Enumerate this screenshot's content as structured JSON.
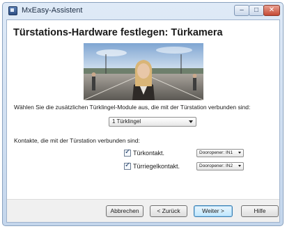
{
  "window": {
    "title": "MxEasy-Assistent",
    "minimize_symbol": "–",
    "maximize_symbol": "□",
    "close_symbol": "✕"
  },
  "page": {
    "heading": "Türstations-Hardware festlegen: Türkamera",
    "camera_image_icon": "camera-snapshot-image"
  },
  "doorbell": {
    "instruction": "Wählen Sie die zusätzlichen Türklingel-Module aus, die mit der Türstation verbunden sind:",
    "selected": "1 Türklingel"
  },
  "contacts": {
    "label": "Kontakte, die mit der Türstation verbunden sind:",
    "items": [
      {
        "checked": true,
        "check_symbol": "✓",
        "label": "Türkontakt.",
        "selected": "Dooropener: IN1"
      },
      {
        "checked": true,
        "check_symbol": "✓",
        "label": "Türriegelkontakt.",
        "selected": "Dooropener: IN2"
      }
    ]
  },
  "buttons": {
    "cancel": "Abbrechen",
    "back": "< Zurück",
    "next": "Weiter >",
    "help": "Hilfe"
  },
  "colors": {
    "window_frame": "#c4d6ec",
    "default_button_border": "#3c7fb1",
    "close_button": "#c54a34"
  }
}
